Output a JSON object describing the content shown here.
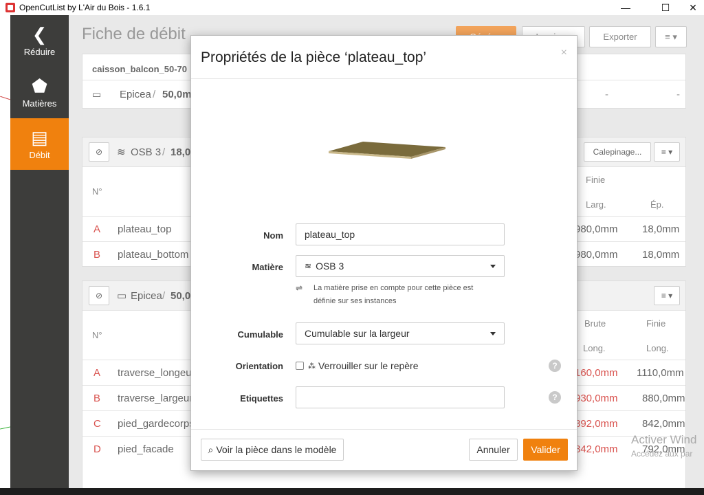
{
  "window": {
    "title": "OpenCutList by L'Air du Bois - 1.6.1",
    "minimize": "—",
    "maximize": "☐",
    "close": "✕"
  },
  "sidebar": {
    "items": [
      {
        "label": "Réduire",
        "icon": "chevron-left-icon",
        "glyph": "❮"
      },
      {
        "label": "Matières",
        "icon": "material-icon",
        "glyph": "⬟"
      },
      {
        "label": "Débit",
        "icon": "cutlist-icon",
        "glyph": "▤"
      }
    ]
  },
  "main": {
    "title": "Fiche de débit",
    "buttons": {
      "generate": "Générer",
      "print": "Imprimer",
      "export": "Exporter",
      "menu": "≡ ▾"
    },
    "summary": {
      "model_name": "caisson_balcon_50-70",
      "material": "Epicea",
      "thickness": "50,0m",
      "dash1": "-",
      "dash2": "-"
    },
    "group1": {
      "material": "OSB 3",
      "thickness": "18,0m",
      "layout_btn": "Calepinage...",
      "menu_btn": "≡ ▾",
      "header": {
        "num": "N°",
        "finie": "Finie",
        "larg": "Larg.",
        "ep": "Ép."
      },
      "rows": [
        {
          "letter": "A",
          "name": "plateau_top",
          "brute": "980,0mm",
          "finie": "18,0mm"
        },
        {
          "letter": "B",
          "name": "plateau_bottom",
          "brute": "980,0mm",
          "finie": "18,0mm"
        }
      ]
    },
    "group2": {
      "material": "Epicea",
      "thickness": "50,0",
      "menu_btn": "≡ ▾",
      "header": {
        "num": "N°",
        "brute": "Brute",
        "finie": "Finie",
        "long1": "Long.",
        "long2": "Long."
      },
      "rows": [
        {
          "letter": "A",
          "name": "traverse_longeur",
          "brute": "160,0mm",
          "finie": "1110,0mm"
        },
        {
          "letter": "B",
          "name": "traverse_largeur",
          "brute": "930,0mm",
          "finie": "880,0mm"
        },
        {
          "letter": "C",
          "name": "pied_gardecorps",
          "brute": "892,0mm",
          "finie": "842,0mm"
        },
        {
          "letter": "D",
          "name": "pied_facade",
          "brute": "842,0mm",
          "finie": "792,0mm"
        }
      ]
    }
  },
  "modal": {
    "title": "Propriétés de la pièce ‘plateau_top’",
    "close": "×",
    "fields": {
      "name_label": "Nom",
      "name_value": "plateau_top",
      "material_label": "Matière",
      "material_value": "OSB 3",
      "material_help": "La matière prise en compte pour cette pièce est définie sur ses instances",
      "cumulable_label": "Cumulable",
      "cumulable_value": "Cumulable sur la largeur",
      "orientation_label": "Orientation",
      "orientation_checkbox": "Verrouiller sur le repère",
      "labels_label": "Etiquettes",
      "labels_value": ""
    },
    "help_glyph": "?",
    "buttons": {
      "view": "Voir la pièce dans le modèle",
      "cancel": "Annuler",
      "ok": "Valider"
    }
  },
  "watermark": {
    "line1": "Activer Wind",
    "line2": "Accédez aux par"
  }
}
